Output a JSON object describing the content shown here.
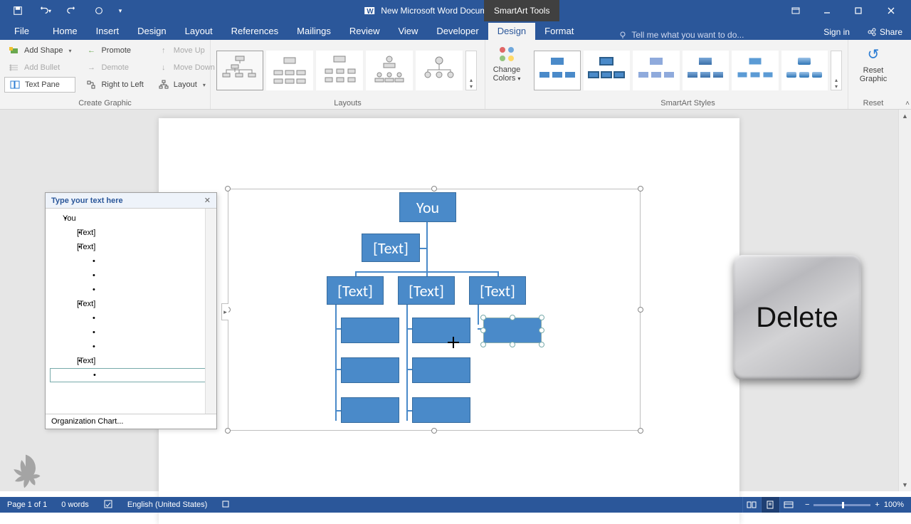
{
  "window": {
    "title": "New Microsoft Word Document.docx - Word",
    "tools_context": "SmartArt Tools"
  },
  "tabs": {
    "file": "File",
    "home": "Home",
    "insert": "Insert",
    "design_main": "Design",
    "layout": "Layout",
    "references": "References",
    "mailings": "Mailings",
    "review": "Review",
    "view": "View",
    "developer": "Developer",
    "design": "Design",
    "format": "Format",
    "tellme": "Tell me what you want to do...",
    "signin": "Sign in",
    "share": "Share"
  },
  "ribbon": {
    "create_graphic": {
      "label": "Create Graphic",
      "add_shape": "Add Shape",
      "add_bullet": "Add Bullet",
      "text_pane": "Text Pane",
      "promote": "Promote",
      "demote": "Demote",
      "right_to_left": "Right to Left",
      "move_up": "Move Up",
      "move_down": "Move Down",
      "layout_btn": "Layout"
    },
    "layouts": {
      "label": "Layouts"
    },
    "change_colors": {
      "label": "Change Colors"
    },
    "styles": {
      "label": "SmartArt Styles"
    },
    "reset": {
      "label": "Reset",
      "reset_graphic": "Reset Graphic"
    }
  },
  "textpane": {
    "title": "Type your text here",
    "footer": "Organization Chart...",
    "items": [
      {
        "level": 0,
        "text": "You"
      },
      {
        "level": 1,
        "text": "[Text]"
      },
      {
        "level": 1,
        "text": "[Text]"
      },
      {
        "level": 2,
        "text": ""
      },
      {
        "level": 2,
        "text": ""
      },
      {
        "level": 2,
        "text": ""
      },
      {
        "level": 1,
        "text": "[Text]"
      },
      {
        "level": 2,
        "text": ""
      },
      {
        "level": 2,
        "text": ""
      },
      {
        "level": 2,
        "text": ""
      },
      {
        "level": 1,
        "text": "[Text]"
      },
      {
        "level": 2,
        "text": ""
      }
    ]
  },
  "smartart": {
    "root": "You",
    "assistant": "[Text]",
    "children": [
      "[Text]",
      "[Text]",
      "[Text]"
    ]
  },
  "status": {
    "page": "Page 1 of 1",
    "words": "0 words",
    "lang": "English (United States)",
    "zoom": "100%"
  },
  "overlay": {
    "delete_key": "Delete"
  }
}
